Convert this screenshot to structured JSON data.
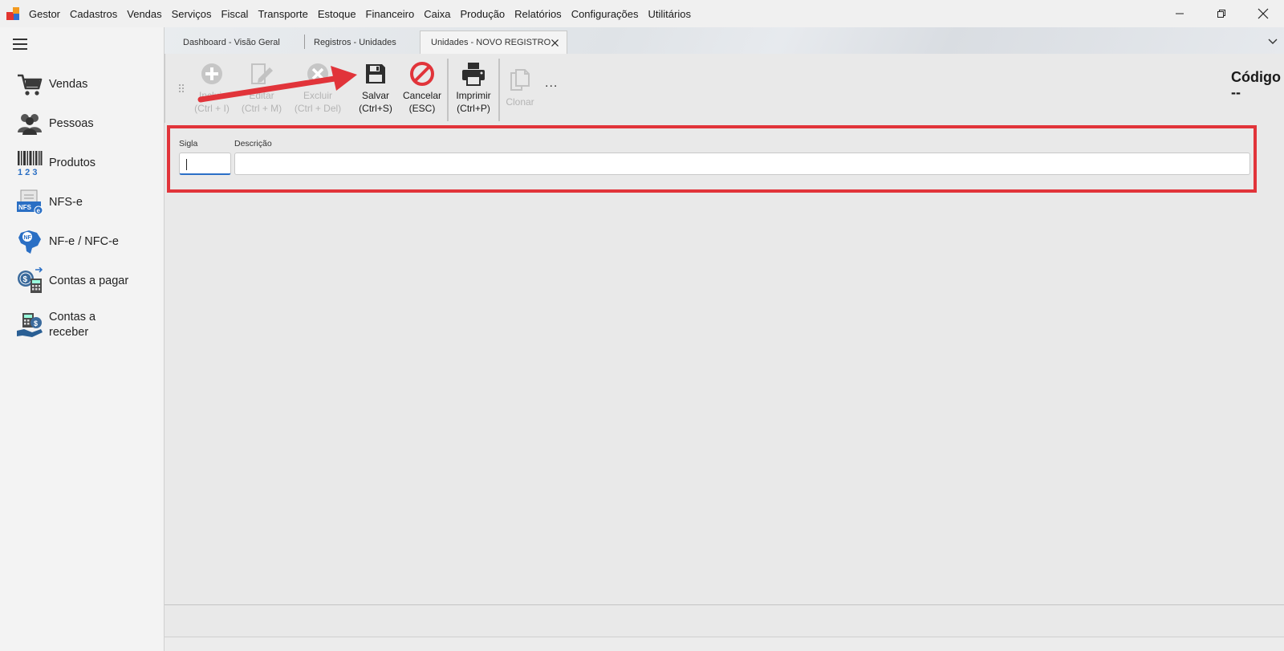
{
  "titlebar": {
    "menu": [
      "Gestor",
      "Cadastros",
      "Vendas",
      "Serviços",
      "Fiscal",
      "Transporte",
      "Estoque",
      "Financeiro",
      "Caixa",
      "Produção",
      "Relatórios",
      "Configurações",
      "Utilitários"
    ],
    "controls": [
      "minimize-icon",
      "restore-icon",
      "close-icon"
    ]
  },
  "sidebar": {
    "items": [
      {
        "label": "Vendas",
        "icon": "cart-icon"
      },
      {
        "label": "Pessoas",
        "icon": "people-icon"
      },
      {
        "label": "Produtos",
        "icon": "barcode-icon"
      },
      {
        "label": "NFS-e",
        "icon": "nfse-icon"
      },
      {
        "label": "NF-e / NFC-e",
        "icon": "nfe-map-icon"
      },
      {
        "label": "Contas a pagar",
        "icon": "bills-pay-icon"
      },
      {
        "label": "Contas a receber",
        "icon": "bills-receive-icon"
      }
    ]
  },
  "tabs": [
    {
      "label": "Dashboard - Visão Geral",
      "active": false
    },
    {
      "label": "Registros - Unidades",
      "active": false
    },
    {
      "label": "Unidades - NOVO REGISTRO",
      "active": true
    }
  ],
  "toolbar": {
    "incluir": {
      "line1": "Incluir",
      "line2": "(Ctrl + I)"
    },
    "editar": {
      "line1": "Editar",
      "line2": "(Ctrl + M)"
    },
    "excluir": {
      "line1": "Excluir",
      "line2": "(Ctrl + Del)"
    },
    "salvar": {
      "line1": "Salvar",
      "line2": "(Ctrl+S)"
    },
    "cancelar": {
      "line1": "Cancelar",
      "line2": "(ESC)"
    },
    "imprimir": {
      "line1": "Imprimir",
      "line2": "(Ctrl+P)"
    },
    "clonar": {
      "line1": "Clonar"
    },
    "more": "..."
  },
  "record": {
    "codigo_label": "Código",
    "codigo_value": "--"
  },
  "form": {
    "sigla_label": "Sigla",
    "sigla_value": "",
    "descricao_label": "Descrição",
    "descricao_value": ""
  },
  "colors": {
    "annotation_red": "#e1343a",
    "cancel_red": "#e1343a",
    "focus_blue": "#2b6fc7"
  }
}
